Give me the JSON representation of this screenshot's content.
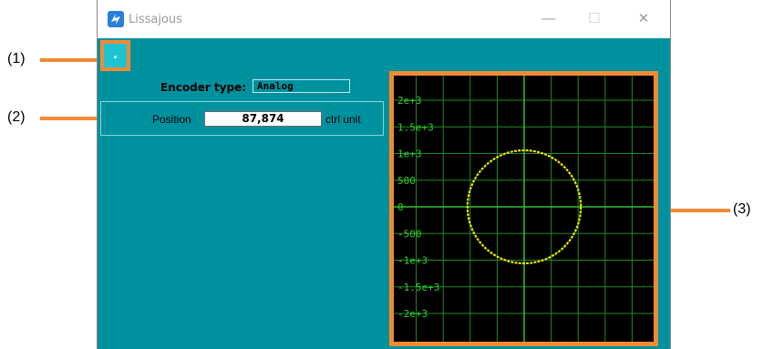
{
  "window": {
    "title": "Lissajous",
    "minimize_glyph": "—",
    "maximize_glyph": "☐",
    "close_glyph": "✕"
  },
  "toolbar": {
    "dot_button_label": "."
  },
  "encoder": {
    "label": "Encoder type:",
    "value": "Analog"
  },
  "position": {
    "label": "Position",
    "value": "87,874",
    "unit": "ctrl unit"
  },
  "plot": {
    "y_tick_labels": [
      "2e+3",
      "1.5e+3",
      "1e+3",
      "500",
      "0",
      "-500",
      "-1e+3",
      "-1.5e+3",
      "-2e+3"
    ],
    "grid_color": "#1f8a1f",
    "axis_color": "#2fbf2f",
    "label_color": "#2fd02f",
    "trace_color": "#e6e600",
    "background": "#000000"
  },
  "chart_data": {
    "type": "scatter",
    "ylim": [
      -2300,
      2300
    ],
    "xlim": [
      -2300,
      2300
    ],
    "y_ticks": [
      2000,
      1500,
      1000,
      500,
      0,
      -500,
      -1000,
      -1500,
      -2000
    ],
    "trace": {
      "shape": "circle",
      "center": [
        0,
        0
      ],
      "radius": 1000
    }
  },
  "annotations": [
    {
      "label": "(1)"
    },
    {
      "label": "(2)"
    },
    {
      "label": "(3)"
    }
  ],
  "colors": {
    "accent": "#f08a33",
    "client_bg": "#00919f"
  }
}
